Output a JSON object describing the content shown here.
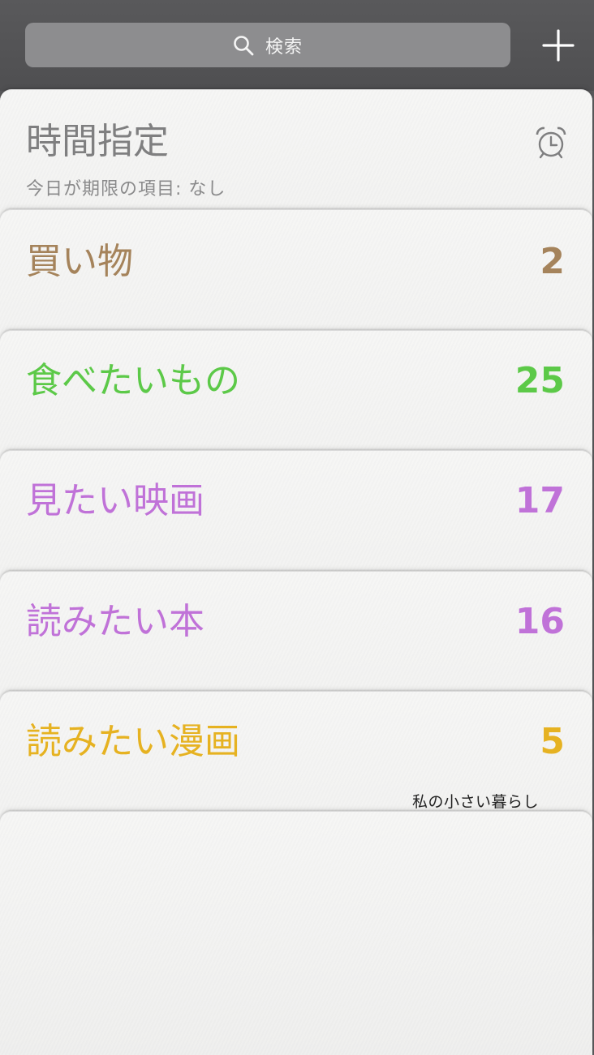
{
  "search": {
    "placeholder": "検索",
    "icon": "search-icon"
  },
  "toolbar": {
    "add_icon": "plus-icon"
  },
  "scheduled": {
    "title": "時間指定",
    "subtitle": "今日が期限の項目: なし",
    "icon": "alarm-clock-icon"
  },
  "lists": [
    {
      "label": "買い物",
      "count": "2",
      "color": "#a5835b"
    },
    {
      "label": "食べたいもの",
      "count": "25",
      "color": "#5cc948"
    },
    {
      "label": "見たい映画",
      "count": "17",
      "color": "#c072d8"
    },
    {
      "label": "読みたい本",
      "count": "16",
      "color": "#c072d8"
    },
    {
      "label": "読みたい漫画",
      "count": "5",
      "color": "#e6b221"
    }
  ],
  "watermark": "私の小さい暮らし"
}
